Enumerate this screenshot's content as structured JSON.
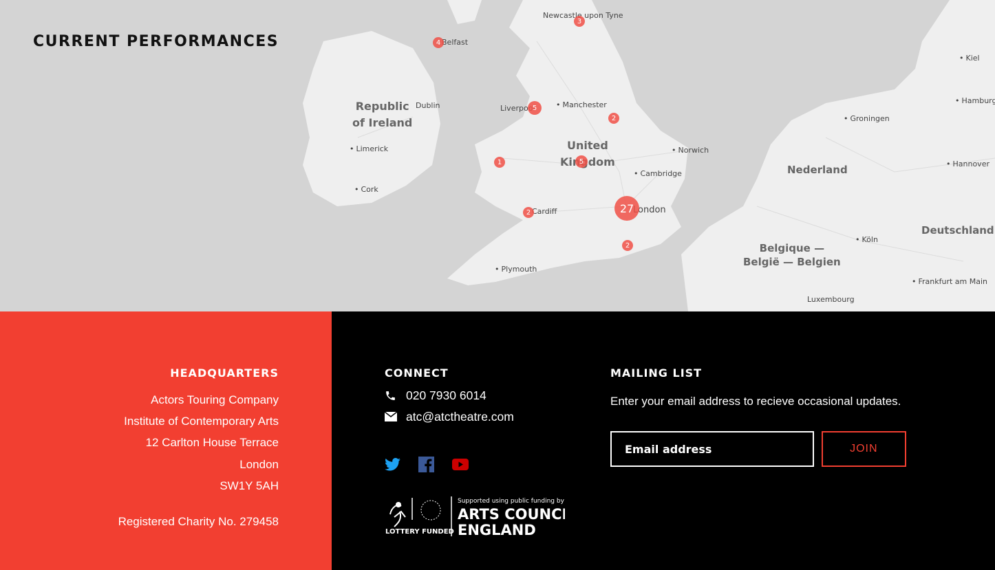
{
  "map": {
    "title": "CURRENT PERFORMANCES",
    "countries": {
      "ireland": [
        "Republic",
        "of Ireland"
      ],
      "uk": [
        "United",
        "Kingdom"
      ],
      "nederland": "Nederland",
      "belgique": [
        "Belgique —",
        "België — Belgien"
      ],
      "deutschland": "Deutschland"
    },
    "places": {
      "newcastle": "Newcastle upon Tyne",
      "belfast": "Belfast",
      "dublin": "Dublin",
      "liverpool": "Liverpool",
      "manchester": "Manchester",
      "limerick": "Limerick",
      "cork": "Cork",
      "norwich": "Norwich",
      "cambridge": "Cambridge",
      "cardiff": "Cardiff",
      "london": "London",
      "plymouth": "Plymouth",
      "kiel": "Kiel",
      "hamburg": "Hamburg",
      "groningen": "Groningen",
      "hannover": "Hannover",
      "koln": "Köln",
      "frankfurt": "Frankfurt am Main",
      "luxembourg": "Luxembourg"
    },
    "markers": {
      "newcastle": "3",
      "belfast": "4",
      "liverpool": "5",
      "yorkshire": "2",
      "wales": "1",
      "midlands": "5",
      "london": "27",
      "cardiff": "2",
      "brighton": "2"
    },
    "accent_color": "#f05046"
  },
  "headquarters": {
    "title": "HEADQUARTERS",
    "address": [
      "Actors Touring Company",
      "Institute of Contemporary Arts",
      "12 Carlton House Terrace",
      "London",
      "SW1Y 5AH"
    ],
    "charity": "Registered Charity No. 279458",
    "bg_color": "#f23f31"
  },
  "connect": {
    "title": "CONNECT",
    "phone": "020 7930 6014",
    "email": "atc@atctheatre.com",
    "social": {
      "twitter_icon": "twitter-icon",
      "facebook_icon": "facebook-icon",
      "youtube_icon": "youtube-icon"
    },
    "funding": {
      "lottery": "LOTTERY FUNDED",
      "supported": "Supported using public funding by",
      "acl1": "ARTS COUNCIL",
      "acl2": "ENGLAND"
    }
  },
  "mailing": {
    "title": "MAILING LIST",
    "description": "Enter your email address to recieve occasional updates.",
    "placeholder": "Email address",
    "join_label": "JOIN"
  }
}
